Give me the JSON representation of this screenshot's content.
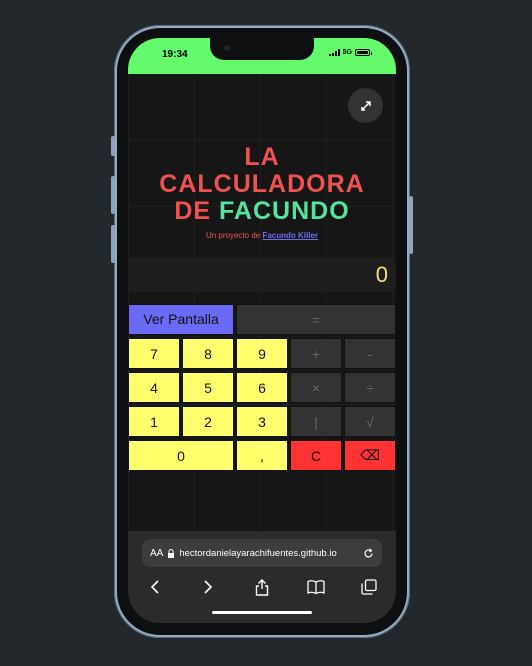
{
  "status_bar": {
    "time": "19:34",
    "network": "5G",
    "color": "#65fa6b"
  },
  "header": {
    "title_line1": "LA",
    "title_line2": "CALCULADORA",
    "title_line3_part1": "DE",
    "title_line3_part2": "FACUNDO",
    "subtitle_prefix": "Un proyecto de",
    "subtitle_link": "Facundo Killer"
  },
  "display": {
    "value": "0"
  },
  "keypad": {
    "ver_pantalla": "Ver Pantalla",
    "equals": "=",
    "seven": "7",
    "eight": "8",
    "nine": "9",
    "plus": "+",
    "minus": "-",
    "four": "4",
    "five": "5",
    "six": "6",
    "times": "×",
    "divide": "÷",
    "one": "1",
    "two": "2",
    "three": "3",
    "pipe": "|",
    "sqrt": "√",
    "zero": "0",
    "comma": ",",
    "clear": "C",
    "backspace": "⌫"
  },
  "browser": {
    "aa_label": "AA",
    "url": "hectordanielayarachifuentes.github.io"
  },
  "colors": {
    "accent_yellow": "#ffff6e",
    "accent_blue": "#6a6af7",
    "accent_red": "#ff3333",
    "title_red": "#ee5350",
    "title_green": "#56e39b"
  }
}
